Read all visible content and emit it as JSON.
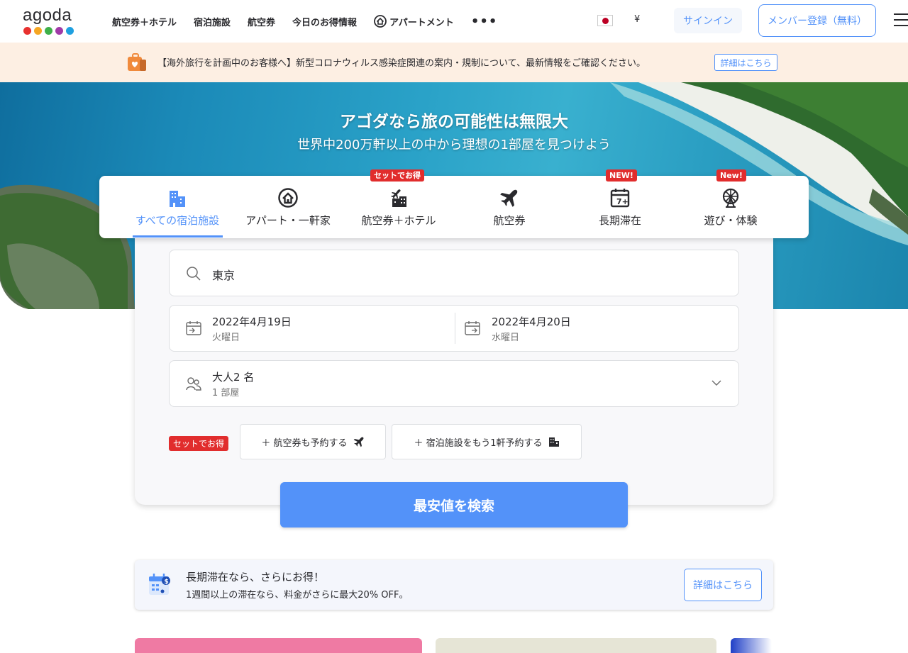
{
  "header": {
    "logo_text": "agoda",
    "logo_dot_colors": [
      "#e8312f",
      "#f5a623",
      "#3eb049",
      "#a03aa8",
      "#1fa0e0"
    ],
    "nav": [
      {
        "label": "航空券＋ホテル",
        "icon": ""
      },
      {
        "label": "宿泊施設",
        "icon": ""
      },
      {
        "label": "航空券",
        "icon": ""
      },
      {
        "label": "今日のお得情報",
        "icon": ""
      },
      {
        "label": "アパートメント",
        "icon": "house-icon"
      }
    ],
    "more_label": "•••",
    "currency": "¥",
    "signin": "サインイン",
    "register": "メンバー登録（無料）"
  },
  "notice": {
    "text": "【海外旅行を計画中のお客様へ】新型コロナウィルス感染症関連の案内・規制について、最新情報をご確認ください。",
    "button": "詳細はこちら"
  },
  "hero": {
    "title": "アゴダなら旅の可能性は無限大",
    "subtitle": "世界中200万軒以上の中から理想の1部屋を見つけよう"
  },
  "tabs": [
    {
      "label": "すべての宿泊施設",
      "badge": "",
      "icon": "hotel-icon",
      "active": true
    },
    {
      "label": "アパート・一軒家",
      "badge": "",
      "icon": "house-icon",
      "active": false
    },
    {
      "label": "航空券＋ホテル",
      "badge": "セットでお得",
      "icon": "flight-hotel-icon",
      "active": false
    },
    {
      "label": "航空券",
      "badge": "",
      "icon": "airplane-icon",
      "active": false
    },
    {
      "label": "長期滞在",
      "badge": "NEW!",
      "icon": "calendar-7-icon",
      "active": false
    },
    {
      "label": "遊び・体験",
      "badge": "New!",
      "icon": "ferris-wheel-icon",
      "active": false
    }
  ],
  "search": {
    "destination": "東京",
    "checkin_date": "2022年4月19日",
    "checkin_day": "火曜日",
    "checkout_date": "2022年4月20日",
    "checkout_day": "水曜日",
    "guests": "大人2 名",
    "rooms": "1 部屋",
    "combo_badge": "セットでお得",
    "add_flight": "＋ 航空券も予約する",
    "add_hotel": "＋ 宿泊施設をもう1軒予約する",
    "search_button": "最安値を検索"
  },
  "promo": {
    "title": "長期滞在なら、さらにお得！",
    "subtitle": "1週間以上の滞在なら、料金がさらに最大20% OFF。",
    "button": "詳細はこちら"
  },
  "colors": {
    "accent": "#5392f9",
    "badge_red": "#e12d2d",
    "notice_bg": "#fdefe3"
  }
}
